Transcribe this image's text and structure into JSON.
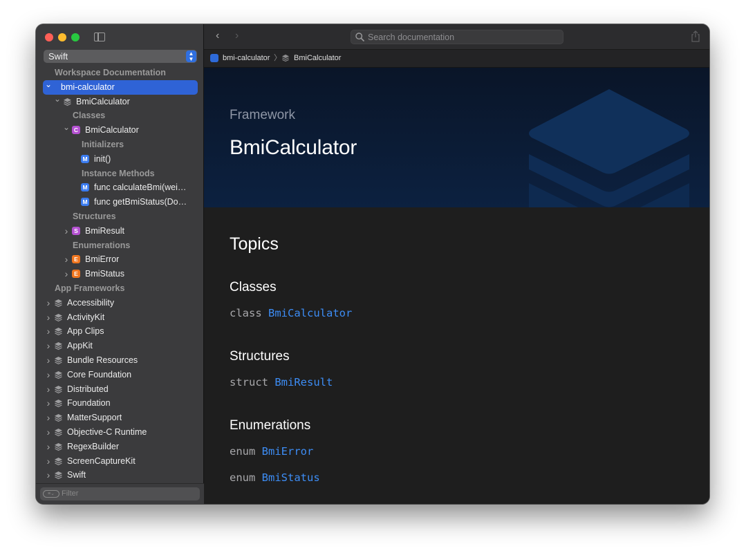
{
  "sidebar": {
    "language_selector": "Swift",
    "tree": [
      {
        "kind": "section",
        "label": "Workspace Documentation",
        "indent": 0
      },
      {
        "kind": "item",
        "label": "bmi-calculator",
        "chevron": "open",
        "selected": true,
        "indent": 0,
        "icon": "none"
      },
      {
        "kind": "item",
        "label": "BmiCalculator",
        "chevron": "open",
        "indent": 1,
        "icon": "framework"
      },
      {
        "kind": "section",
        "label": "Classes",
        "indent": 2
      },
      {
        "kind": "item",
        "label": "BmiCalculator",
        "chevron": "open",
        "indent": 2,
        "icon": "C"
      },
      {
        "kind": "section",
        "label": "Initializers",
        "indent": 3
      },
      {
        "kind": "item",
        "label": "init()",
        "chevron": "none",
        "indent": 3,
        "icon": "M"
      },
      {
        "kind": "section",
        "label": "Instance Methods",
        "indent": 3
      },
      {
        "kind": "item",
        "label": "func calculateBmi(wei…",
        "chevron": "none",
        "indent": 3,
        "icon": "M"
      },
      {
        "kind": "item",
        "label": "func getBmiStatus(Do…",
        "chevron": "none",
        "indent": 3,
        "icon": "M"
      },
      {
        "kind": "section",
        "label": "Structures",
        "indent": 2
      },
      {
        "kind": "item",
        "label": "BmiResult",
        "chevron": "closed",
        "indent": 2,
        "icon": "S"
      },
      {
        "kind": "section",
        "label": "Enumerations",
        "indent": 2
      },
      {
        "kind": "item",
        "label": "BmiError",
        "chevron": "closed",
        "indent": 2,
        "icon": "E"
      },
      {
        "kind": "item",
        "label": "BmiStatus",
        "chevron": "closed",
        "indent": 2,
        "icon": "E"
      },
      {
        "kind": "section",
        "label": "App Frameworks",
        "indent": 0
      },
      {
        "kind": "item",
        "label": "Accessibility",
        "chevron": "closed",
        "indent": 0,
        "icon": "framework"
      },
      {
        "kind": "item",
        "label": "ActivityKit",
        "chevron": "closed",
        "indent": 0,
        "icon": "framework"
      },
      {
        "kind": "item",
        "label": "App Clips",
        "chevron": "closed",
        "indent": 0,
        "icon": "framework"
      },
      {
        "kind": "item",
        "label": "AppKit",
        "chevron": "closed",
        "indent": 0,
        "icon": "framework"
      },
      {
        "kind": "item",
        "label": "Bundle Resources",
        "chevron": "closed",
        "indent": 0,
        "icon": "framework"
      },
      {
        "kind": "item",
        "label": "Core Foundation",
        "chevron": "closed",
        "indent": 0,
        "icon": "framework"
      },
      {
        "kind": "item",
        "label": "Distributed",
        "chevron": "closed",
        "indent": 0,
        "icon": "framework"
      },
      {
        "kind": "item",
        "label": "Foundation",
        "chevron": "closed",
        "indent": 0,
        "icon": "framework"
      },
      {
        "kind": "item",
        "label": "MatterSupport",
        "chevron": "closed",
        "indent": 0,
        "icon": "framework"
      },
      {
        "kind": "item",
        "label": "Objective-C Runtime",
        "chevron": "closed",
        "indent": 0,
        "icon": "framework"
      },
      {
        "kind": "item",
        "label": "RegexBuilder",
        "chevron": "closed",
        "indent": 0,
        "icon": "framework"
      },
      {
        "kind": "item",
        "label": "ScreenCaptureKit",
        "chevron": "closed",
        "indent": 0,
        "icon": "framework"
      },
      {
        "kind": "item",
        "label": "Swift",
        "chevron": "closed",
        "indent": 0,
        "icon": "framework"
      }
    ],
    "filter": {
      "placeholder": "Filter"
    }
  },
  "toolbar": {
    "search_placeholder": "Search documentation"
  },
  "breadcrumb": {
    "project": "bmi-calculator",
    "current": "BmiCalculator"
  },
  "hero": {
    "eyebrow": "Framework",
    "title": "BmiCalculator"
  },
  "topics": {
    "title": "Topics",
    "groups": [
      {
        "title": "Classes",
        "decls": [
          {
            "keyword": "class",
            "name": "BmiCalculator"
          }
        ]
      },
      {
        "title": "Structures",
        "decls": [
          {
            "keyword": "struct",
            "name": "BmiResult"
          }
        ]
      },
      {
        "title": "Enumerations",
        "decls": [
          {
            "keyword": "enum",
            "name": "BmiError"
          },
          {
            "keyword": "enum",
            "name": "BmiStatus"
          }
        ]
      }
    ]
  },
  "colors": {
    "selection": "#2f63d6",
    "link": "#3d8df5",
    "class_badge": "#b451d1",
    "method_badge": "#3b7cf0",
    "enum_badge": "#f0761f",
    "hero_bg": "#0c2140"
  },
  "icons": {
    "framework": "stack-layers-icon",
    "class": "class-badge-icon",
    "method": "method-badge-icon",
    "struct": "struct-badge-icon",
    "enum": "enum-badge-icon",
    "search": "search-icon",
    "share": "share-icon"
  }
}
